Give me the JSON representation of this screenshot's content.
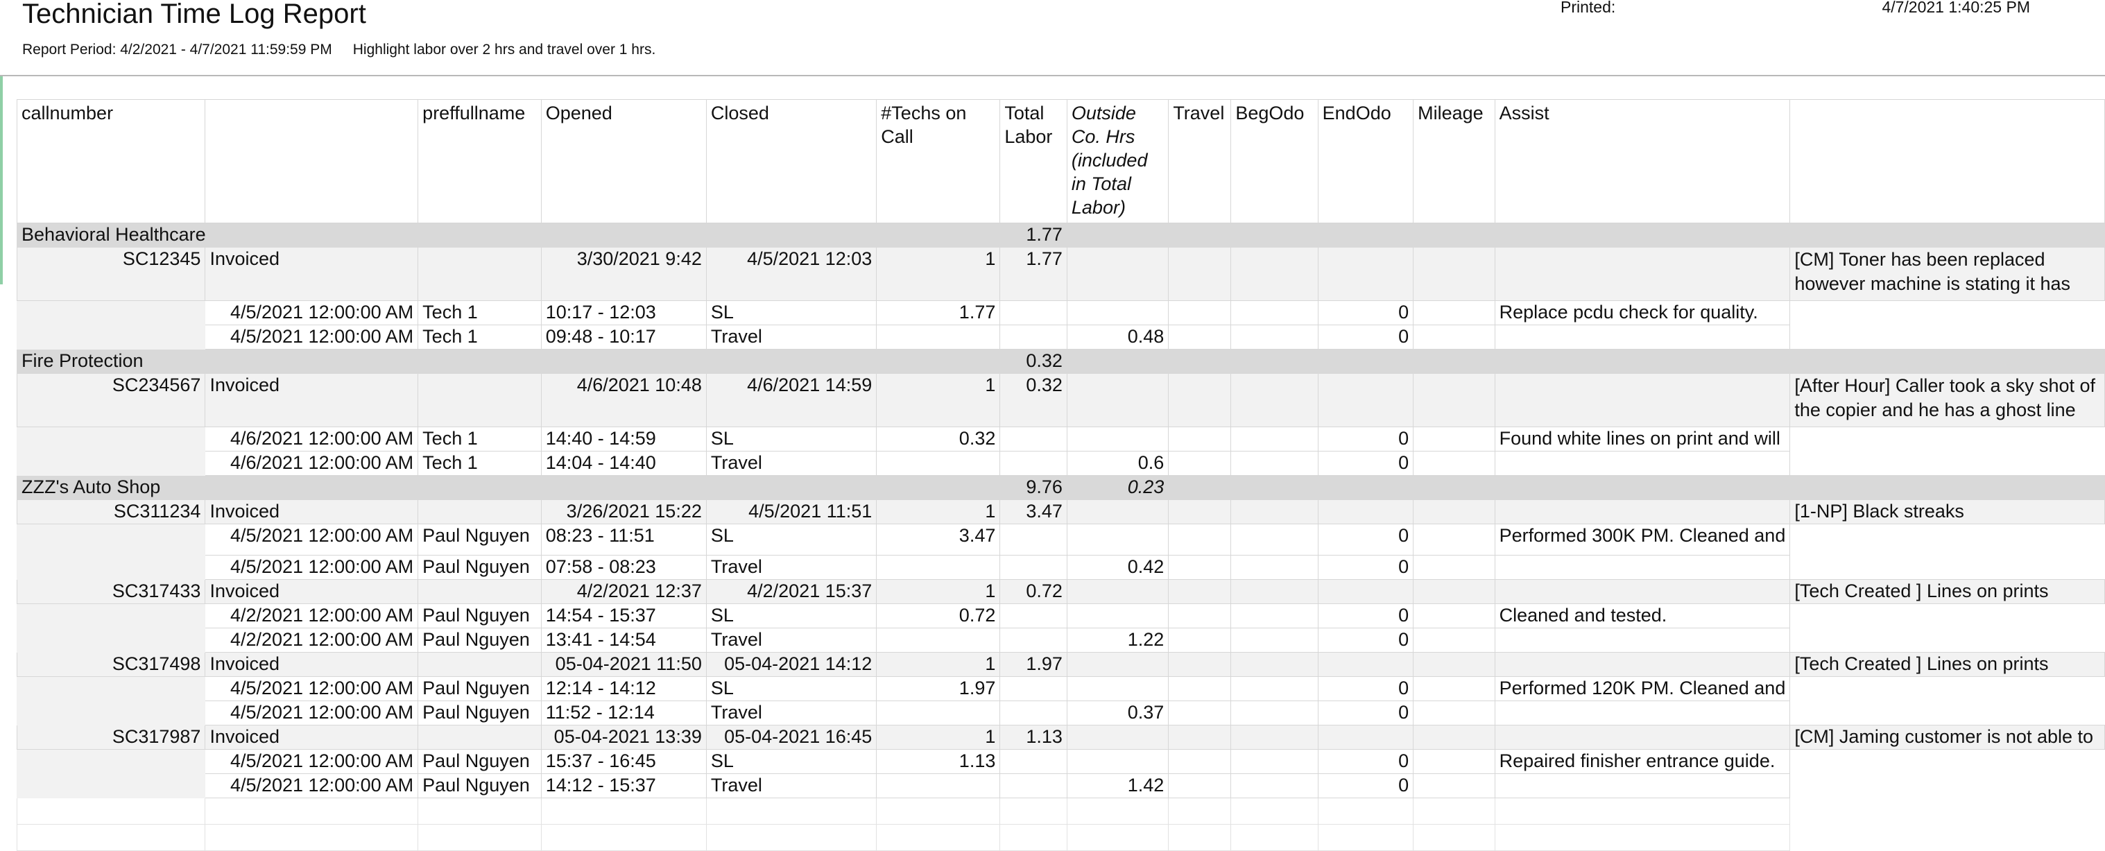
{
  "report": {
    "title": "Technician Time Log Report",
    "period": "Report Period: 4/2/2021 - 4/7/2021 11:59:59 PM",
    "highlight": "Highlight labor over 2 hrs and travel over 1 hrs.",
    "printed_label": "Printed:",
    "printed_value": "4/7/2021 1:40:25 PM"
  },
  "columns": [
    "callnumber",
    "",
    "preffullname",
    "Opened",
    "Closed",
    "#Techs on Call",
    "Total Labor",
    "Outside Co. Hrs (included in Total Labor)",
    "Travel",
    "BegOdo",
    "EndOdo",
    "Mileage",
    "Assist",
    ""
  ],
  "groups": [
    {
      "name": "Behavioral Healthcare",
      "total": "1.77",
      "outside": "",
      "calls": [
        {
          "callnumber": "SC12345",
          "status": "Invoiced",
          "opened": "3/30/2021 9:42",
          "closed": "4/5/2021 12:03",
          "techs": "1",
          "labor": "1.77",
          "note": "[CM] Toner has been replaced however machine is stating it has",
          "lines": [
            {
              "date": "4/5/2021 12:00:00 AM",
              "tech": "Tech 1",
              "time": "10:17 - 12:03",
              "type": "SL",
              "labor": "1.77",
              "travel": "",
              "mileage": "0",
              "note": "Replace pcdu check for quality."
            },
            {
              "date": "4/5/2021 12:00:00 AM",
              "tech": "Tech 1",
              "time": "09:48 - 10:17",
              "type": "Travel",
              "labor": "",
              "travel": "0.48",
              "mileage": "0",
              "note": ""
            }
          ]
        }
      ]
    },
    {
      "name": "Fire Protection",
      "total": "0.32",
      "outside": "",
      "calls": [
        {
          "callnumber": "SC234567",
          "status": "Invoiced",
          "opened": "4/6/2021 10:48",
          "closed": "4/6/2021 14:59",
          "techs": "1",
          "labor": "0.32",
          "note": "[After Hour] Caller took a sky shot of the copier and he has a ghost line",
          "lines": [
            {
              "date": "4/6/2021 12:00:00 AM",
              "tech": "Tech 1",
              "time": "14:40 - 14:59",
              "type": "SL",
              "labor": "0.32",
              "travel": "",
              "mileage": "0",
              "note": "Found white lines on print and will"
            },
            {
              "date": "4/6/2021 12:00:00 AM",
              "tech": "Tech 1",
              "time": "14:04 - 14:40",
              "type": "Travel",
              "labor": "",
              "travel": "0.6",
              "mileage": "0",
              "note": ""
            }
          ]
        }
      ]
    },
    {
      "name": "ZZZ's Auto Shop",
      "total": "9.76",
      "outside": "0.23",
      "calls": [
        {
          "callnumber": "SC311234",
          "status": "Invoiced",
          "opened": "3/26/2021 15:22",
          "closed": "4/5/2021 11:51",
          "techs": "1",
          "labor": "3.47",
          "note": "[1-NP] Black streaks",
          "lines": [
            {
              "date": "4/5/2021 12:00:00 AM",
              "tech": "Paul Nguyen",
              "time": "08:23 - 11:51",
              "type": "SL",
              "labor": "3.47",
              "travel": "",
              "mileage": "0",
              "note": "Performed 300K PM. Cleaned and"
            },
            {
              "date": "4/5/2021 12:00:00 AM",
              "tech": "Paul Nguyen",
              "time": "07:58 - 08:23",
              "type": "Travel",
              "labor": "",
              "travel": "0.42",
              "mileage": "0",
              "note": ""
            }
          ]
        },
        {
          "callnumber": "SC317433",
          "status": "Invoiced",
          "opened": "4/2/2021 12:37",
          "closed": "4/2/2021 15:37",
          "techs": "1",
          "labor": "0.72",
          "note": "[Tech Created ] Lines on prints",
          "lines": [
            {
              "date": "4/2/2021 12:00:00 AM",
              "tech": "Paul Nguyen",
              "time": "14:54 - 15:37",
              "type": "SL",
              "labor": "0.72",
              "travel": "",
              "mileage": "0",
              "note": "Cleaned and tested."
            },
            {
              "date": "4/2/2021 12:00:00 AM",
              "tech": "Paul Nguyen",
              "time": "13:41 - 14:54",
              "type": "Travel",
              "labor": "",
              "travel": "1.22",
              "mileage": "0",
              "note": ""
            }
          ]
        },
        {
          "callnumber": "SC317498",
          "status": "Invoiced",
          "opened": "05-04-2021 11:50",
          "closed": "05-04-2021 14:12",
          "techs": "1",
          "labor": "1.97",
          "note": "[Tech Created ] Lines on prints",
          "lines": [
            {
              "date": "4/5/2021 12:00:00 AM",
              "tech": "Paul Nguyen",
              "time": "12:14 - 14:12",
              "type": "SL",
              "labor": "1.97",
              "travel": "",
              "mileage": "0",
              "note": "Performed 120K PM. Cleaned and"
            },
            {
              "date": "4/5/2021 12:00:00 AM",
              "tech": "Paul Nguyen",
              "time": "11:52 - 12:14",
              "type": "Travel",
              "labor": "",
              "travel": "0.37",
              "mileage": "0",
              "note": ""
            }
          ]
        },
        {
          "callnumber": "SC317987",
          "status": "Invoiced",
          "opened": "05-04-2021 13:39",
          "closed": "05-04-2021 16:45",
          "techs": "1",
          "labor": "1.13",
          "note": "[CM] Jaming customer is not able to",
          "lines": [
            {
              "date": "4/5/2021 12:00:00 AM",
              "tech": "Paul Nguyen",
              "time": "15:37 - 16:45",
              "type": "SL",
              "labor": "1.13",
              "travel": "",
              "mileage": "0",
              "note": "Repaired finisher entrance guide."
            },
            {
              "date": "4/5/2021 12:00:00 AM",
              "tech": "Paul Nguyen",
              "time": "14:12 - 15:37",
              "type": "Travel",
              "labor": "",
              "travel": "1.42",
              "mileage": "0",
              "note": ""
            }
          ]
        }
      ]
    }
  ]
}
